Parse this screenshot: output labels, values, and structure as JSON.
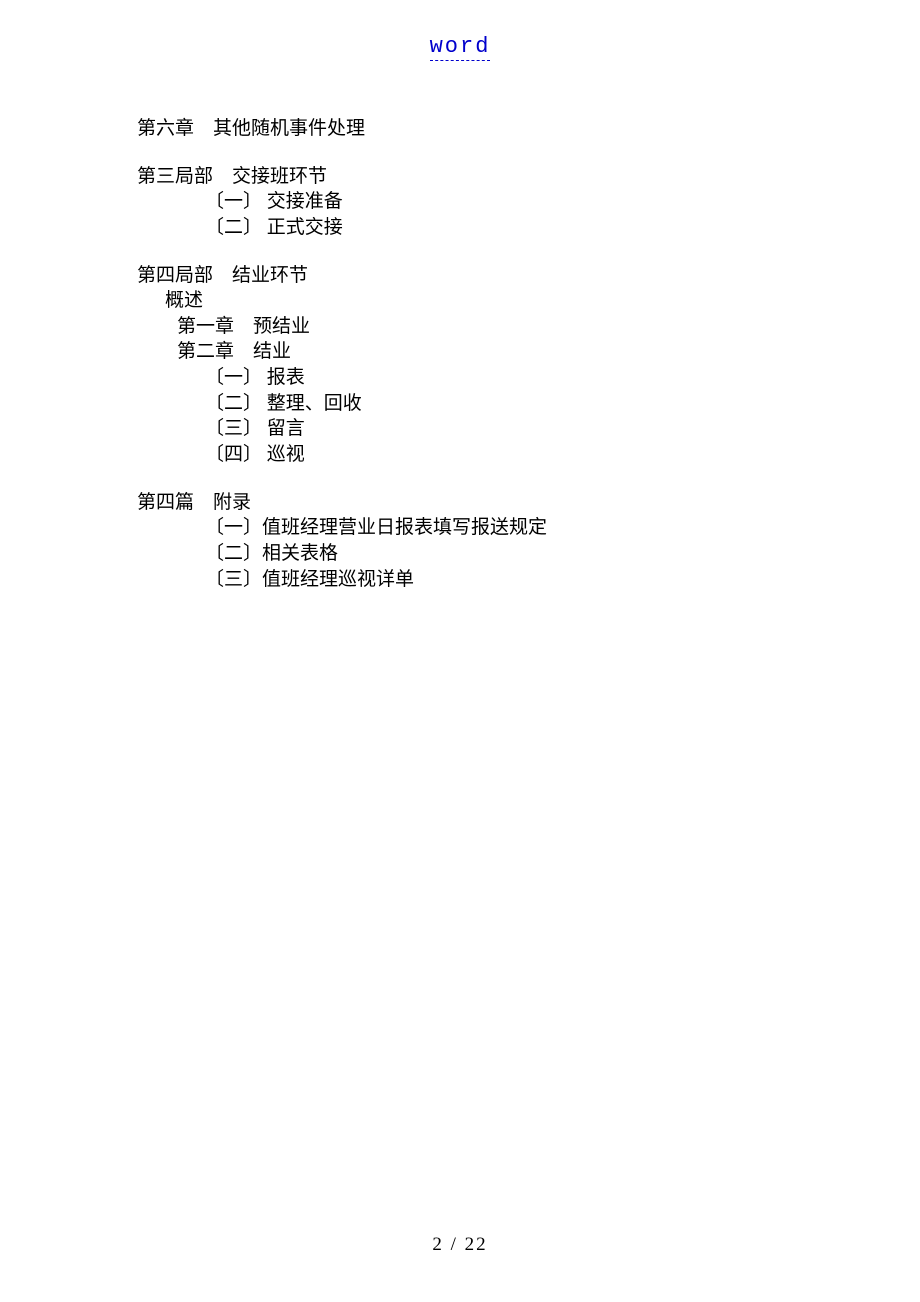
{
  "header": {
    "link_text": "word"
  },
  "toc": {
    "chapter6": "第六章　其他随机事件处理",
    "part3": {
      "title": "第三局部　交接班环节",
      "items": [
        "〔一〕 交接准备",
        "〔二〕 正式交接"
      ]
    },
    "part4a": {
      "title": "第四局部　结业环节",
      "overview": "概述",
      "ch1": "第一章　预结业",
      "ch2": "第二章　结业",
      "ch2_items": [
        "〔一〕 报表",
        "〔二〕 整理、回收",
        "〔三〕 留言",
        "〔四〕 巡视"
      ]
    },
    "part4b": {
      "title": "第四篇　附录",
      "items": [
        "〔一〕值班经理营业日报表填写报送规定",
        "〔二〕相关表格",
        "〔三〕值班经理巡视详单"
      ]
    }
  },
  "footer": {
    "page_info": "2 / 22"
  }
}
